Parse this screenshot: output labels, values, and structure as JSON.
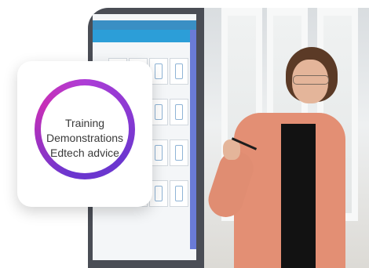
{
  "card": {
    "lines": [
      "Training",
      "Demonstrations",
      "Edtech advice"
    ]
  },
  "colors": {
    "ring_purple": "#6b36cf",
    "ring_magenta": "#c72fb7",
    "screen_blue": "#2c9ed8",
    "shirt_coral": "#e38f74"
  }
}
